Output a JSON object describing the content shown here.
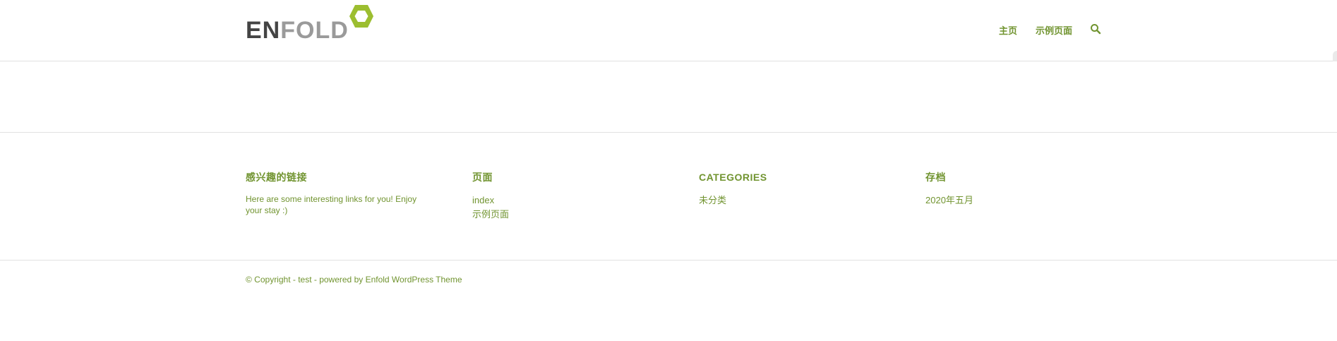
{
  "header": {
    "logo": {
      "text_dark": "EN",
      "text_light": "FOLD",
      "hex_color": "#9cbe30",
      "icon": "hexagon-icon"
    },
    "nav": {
      "items": [
        {
          "label": "主页"
        },
        {
          "label": "示例页面"
        }
      ],
      "search_icon": "search-icon"
    }
  },
  "footer": {
    "widgets": [
      {
        "title": "感兴趣的链接",
        "text": "Here are some interesting links for you! Enjoy your stay :)"
      },
      {
        "title": "页面",
        "items": [
          "index",
          "示例页面"
        ]
      },
      {
        "title": "CATEGORIES",
        "items": [
          "未分类"
        ]
      },
      {
        "title": "存档",
        "items": [
          "2020年五月"
        ]
      }
    ]
  },
  "socket": {
    "copyright": "© Copyright - test - powered by Enfold WordPress Theme"
  },
  "colors": {
    "accent": "#719430",
    "border": "#e1e1e1",
    "logo_dark": "#444444",
    "logo_light": "#9a9a9a"
  }
}
